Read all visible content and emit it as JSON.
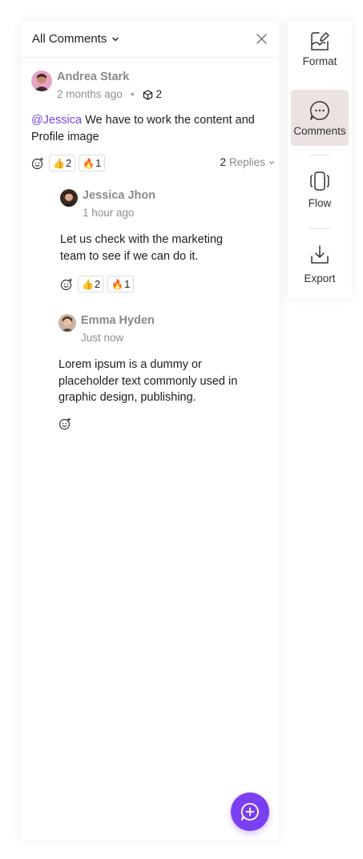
{
  "header": {
    "filter_label": "All Comments"
  },
  "thread": {
    "author": "Andrea Stark",
    "time": "2 months ago",
    "object_count": "2",
    "mention": "@Jessica",
    "text": " We have to work the content and Profile image",
    "reactions": [
      {
        "emoji": "👍",
        "count": "2"
      },
      {
        "emoji": "🔥",
        "count": "1"
      }
    ],
    "replies_count": "2",
    "replies_label": "Replies"
  },
  "replies": [
    {
      "author": "Jessica Jhon",
      "time": "1 hour ago",
      "text": "Let us check with the marketing team to see if we can do it.",
      "reactions": [
        {
          "emoji": "👍",
          "count": "2"
        },
        {
          "emoji": "🔥",
          "count": "1"
        }
      ]
    },
    {
      "author": "Emma Hyden",
      "time": "Just now",
      "text": "Lorem ipsum is a dummy  or placeholder text commonly used in graphic design, publishing."
    }
  ],
  "sidebar": {
    "items": [
      {
        "label": "Format",
        "icon": "format-icon"
      },
      {
        "label": "Comments",
        "icon": "comments-icon"
      },
      {
        "label": "Flow",
        "icon": "flow-icon"
      },
      {
        "label": "Export",
        "icon": "export-icon"
      }
    ]
  },
  "colors": {
    "accent": "#7b3ff2",
    "active_bg": "#ede2e2",
    "mention": "#7b3fe4"
  }
}
